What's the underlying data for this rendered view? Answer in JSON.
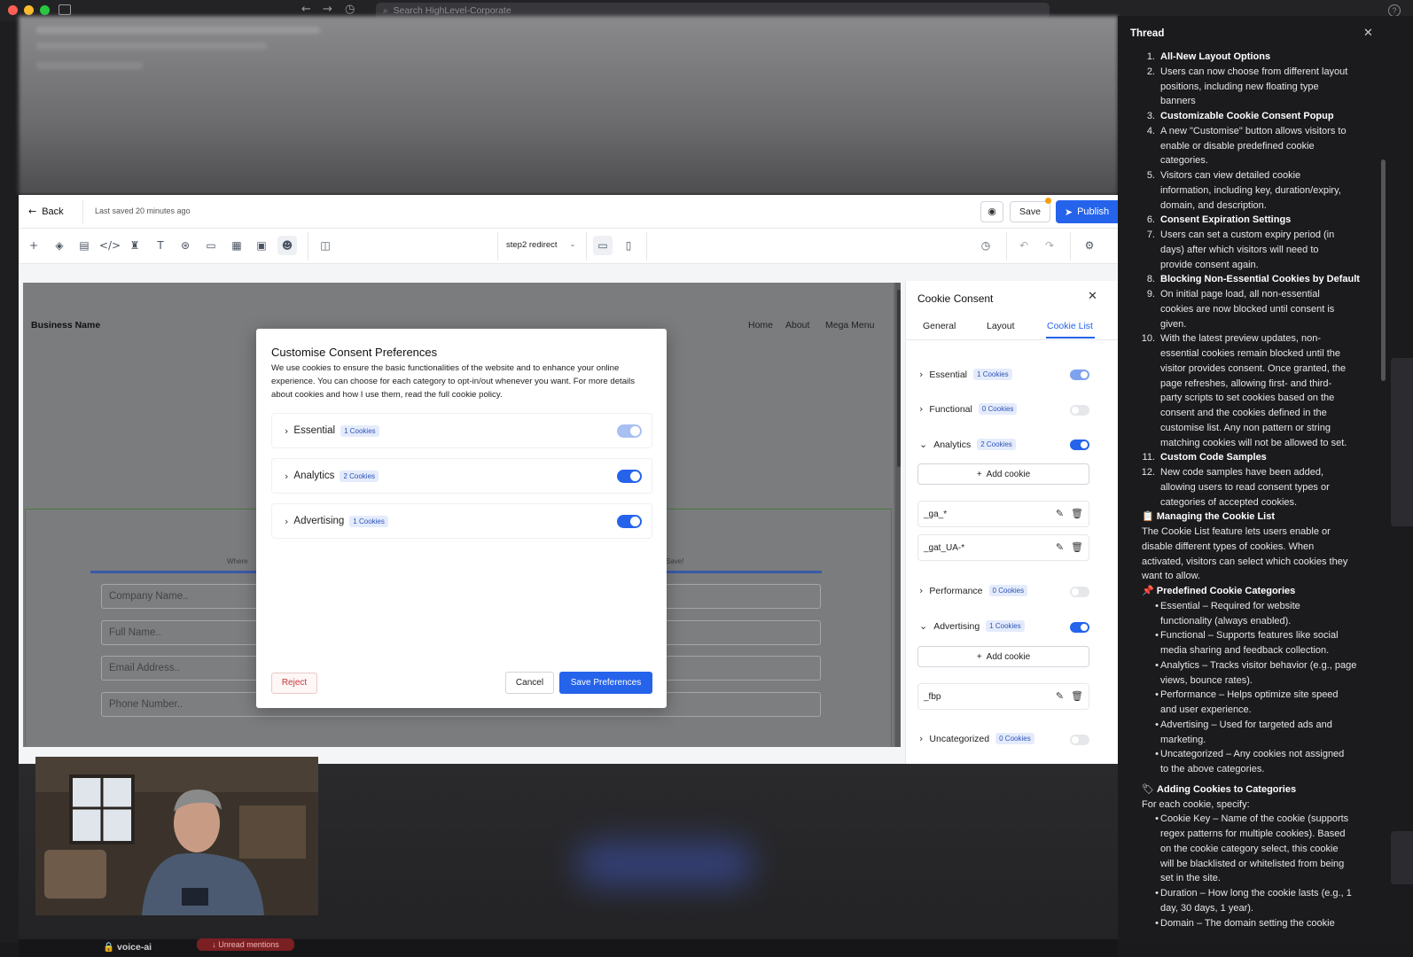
{
  "browser": {
    "search_placeholder": "Search HighLevel-Corporate"
  },
  "editor": {
    "back_label": "Back",
    "last_saved": "Last saved 20 minutes ago",
    "save_label": "Save",
    "publish_label": "Publish",
    "page_name": "step2 redirect"
  },
  "site": {
    "business_name": "Business Name",
    "nav": [
      "Home",
      "About",
      "Mega Menu"
    ],
    "form": {
      "left_caption": "Where",
      "right_caption": "Save!",
      "inputs": [
        "Company Name..",
        "Full Name..",
        "Email Address..",
        "Phone Number.."
      ]
    }
  },
  "modal": {
    "title": "Customise Consent Preferences",
    "description": "We use cookies to ensure the basic functionalities of the website and to enhance your online experience. You can choose for each category to opt-in/out whenever you want. For more details about cookies and how I use them, read the full cookie policy.",
    "categories": [
      {
        "name": "Essential",
        "count": "1 Cookies",
        "enabled": true,
        "locked": true
      },
      {
        "name": "Analytics",
        "count": "2 Cookies",
        "enabled": true,
        "locked": false
      },
      {
        "name": "Advertising",
        "count": "1 Cookies",
        "enabled": true,
        "locked": false
      }
    ],
    "reject_label": "Reject",
    "cancel_label": "Cancel",
    "save_label": "Save Preferences"
  },
  "panel": {
    "title": "Cookie Consent",
    "tabs": [
      "General",
      "Layout",
      "Cookie List"
    ],
    "active_tab": "Cookie List",
    "add_cookie_label": "Add cookie",
    "categories": [
      {
        "name": "Essential",
        "count": "1 Cookies",
        "enabled": true,
        "expanded": false
      },
      {
        "name": "Functional",
        "count": "0 Cookies",
        "enabled": false,
        "expanded": false
      },
      {
        "name": "Analytics",
        "count": "2 Cookies",
        "enabled": true,
        "expanded": true,
        "cookies": [
          "_ga_*",
          "_gat_UA-*"
        ]
      },
      {
        "name": "Performance",
        "count": "0 Cookies",
        "enabled": false,
        "expanded": false
      },
      {
        "name": "Advertising",
        "count": "1 Cookies",
        "enabled": true,
        "expanded": true,
        "cookies": [
          "_fbp"
        ]
      },
      {
        "name": "Uncategorized",
        "count": "0 Cookies",
        "enabled": false,
        "expanded": false
      }
    ]
  },
  "thread": {
    "title": "Thread",
    "lines": [
      {
        "num": "1.",
        "text": "All-New Layout Options",
        "bold": true
      },
      {
        "num": "2.",
        "text": "Users can now choose from different layout"
      },
      {
        "text": "positions, including new floating type"
      },
      {
        "text": "banners"
      },
      {
        "num": "3.",
        "text": "Customizable Cookie Consent Popup",
        "bold": true
      },
      {
        "num": "4.",
        "text": "A new \"Customise\" button allows visitors to"
      },
      {
        "text": "enable or disable predefined cookie"
      },
      {
        "text": "categories."
      },
      {
        "num": "5.",
        "text": "Visitors can view detailed cookie"
      },
      {
        "text": "information, including key, duration/expiry,"
      },
      {
        "text": "domain, and description."
      },
      {
        "num": "6.",
        "text": "Consent Expiration Settings",
        "bold": true
      },
      {
        "num": "7.",
        "text": "Users can set a custom expiry period (in"
      },
      {
        "text": "days) after which visitors will need to"
      },
      {
        "text": "provide consent again."
      },
      {
        "num": "8.",
        "text": "Blocking Non-Essential Cookies by Default",
        "bold": true
      },
      {
        "num": "9.",
        "text": "On initial page load, all non-essential"
      },
      {
        "text": "cookies are now blocked until consent is"
      },
      {
        "text": "given."
      },
      {
        "num": "10.",
        "text": "With the latest preview updates, non-"
      },
      {
        "text": "essential cookies remain blocked until the"
      },
      {
        "text": "visitor provides consent. Once granted, the"
      },
      {
        "text": "page refreshes, allowing first- and third-"
      },
      {
        "text": "party scripts to set cookies based on the"
      },
      {
        "text": "consent and the cookies defined in the"
      },
      {
        "text": "customise list. Any non pattern or string"
      },
      {
        "text": "matching cookies will not be allowed to set."
      },
      {
        "num": "11.",
        "text": "Custom Code Samples",
        "bold": true
      },
      {
        "num": "12.",
        "text": "New code samples have been added,"
      },
      {
        "text": "allowing users to read consent types or"
      },
      {
        "text": "categories of accepted cookies."
      },
      {
        "head": "Managing the Cookie List",
        "emoji": "📋",
        "bold": true
      },
      {
        "plain": "The Cookie List feature lets users enable or"
      },
      {
        "plain": "disable different types of cookies. When"
      },
      {
        "plain": "activated, visitors can select which cookies they"
      },
      {
        "plain": "want to allow."
      },
      {
        "head": "Predefined Cookie Categories",
        "emoji": "📌",
        "bold": true
      },
      {
        "bullet": true,
        "text": "Essential – Required for website"
      },
      {
        "text": "functionality (always enabled)."
      },
      {
        "bullet": true,
        "text": "Functional – Supports features like social"
      },
      {
        "text": "media sharing and feedback collection."
      },
      {
        "bullet": true,
        "text": "Analytics – Tracks visitor behavior (e.g., page"
      },
      {
        "text": "views, bounce rates)."
      },
      {
        "bullet": true,
        "text": "Performance – Helps optimize site speed"
      },
      {
        "text": "and user experience."
      },
      {
        "bullet": true,
        "text": "Advertising – Used for targeted ads and"
      },
      {
        "text": "marketing."
      },
      {
        "bullet": true,
        "text": "Uncategorized – Any cookies not assigned"
      },
      {
        "text": "to the above categories."
      },
      {
        "gap": true
      },
      {
        "head": "Adding Cookies to Categories",
        "emoji": "🏷",
        "bold": true
      },
      {
        "plain": "For each cookie, specify:"
      },
      {
        "bullet": true,
        "text": "Cookie Key – Name of the cookie (supports"
      },
      {
        "text": "regex patterns for multiple cookies). Based"
      },
      {
        "text": "on the cookie category select, this cookie"
      },
      {
        "text": "will be blacklisted or whitelisted from being"
      },
      {
        "text": "set in the site."
      },
      {
        "bullet": true,
        "text": "Duration – How long the cookie lasts (e.g., 1"
      },
      {
        "text": "day, 30 days, 1 year)."
      },
      {
        "bullet": true,
        "text": "Domain – The domain setting the cookie"
      }
    ]
  },
  "slack": {
    "channel": "voice-ai",
    "unread": "Unread mentions"
  },
  "colors": {
    "accent": "#2563eb",
    "danger": "#c2383a",
    "thread_bg": "#1b1b1e"
  }
}
